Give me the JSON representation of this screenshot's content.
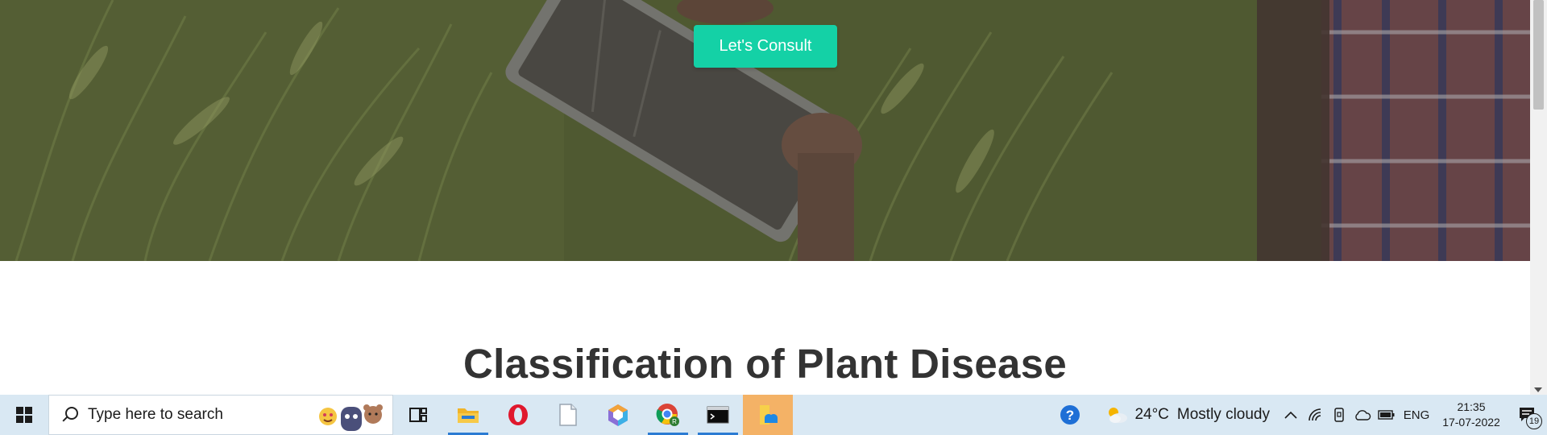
{
  "hero": {
    "cta_label": "Let's Consult"
  },
  "section": {
    "title": "Classification of Plant Disease"
  },
  "taskbar": {
    "search_placeholder": "Type here to search",
    "apps": [
      {
        "name": "task-view",
        "icon": "task-view-icon"
      },
      {
        "name": "file-explorer",
        "icon": "folder-icon"
      },
      {
        "name": "opera",
        "icon": "opera-icon"
      },
      {
        "name": "notepad",
        "icon": "blank-file-icon"
      },
      {
        "name": "3d-app",
        "icon": "cube-icon"
      },
      {
        "name": "chrome",
        "icon": "chrome-icon"
      },
      {
        "name": "terminal",
        "icon": "terminal-icon"
      },
      {
        "name": "file-sharing",
        "icon": "folder-cloud-icon"
      }
    ],
    "weather": {
      "temperature": "24°C",
      "condition": "Mostly cloudy"
    },
    "language": "ENG",
    "time": "21:35",
    "date": "17-07-2022",
    "notification_count": "19"
  },
  "colors": {
    "accent": "#14d1a6",
    "taskbar": "#d9e8f3",
    "title": "#333333"
  }
}
